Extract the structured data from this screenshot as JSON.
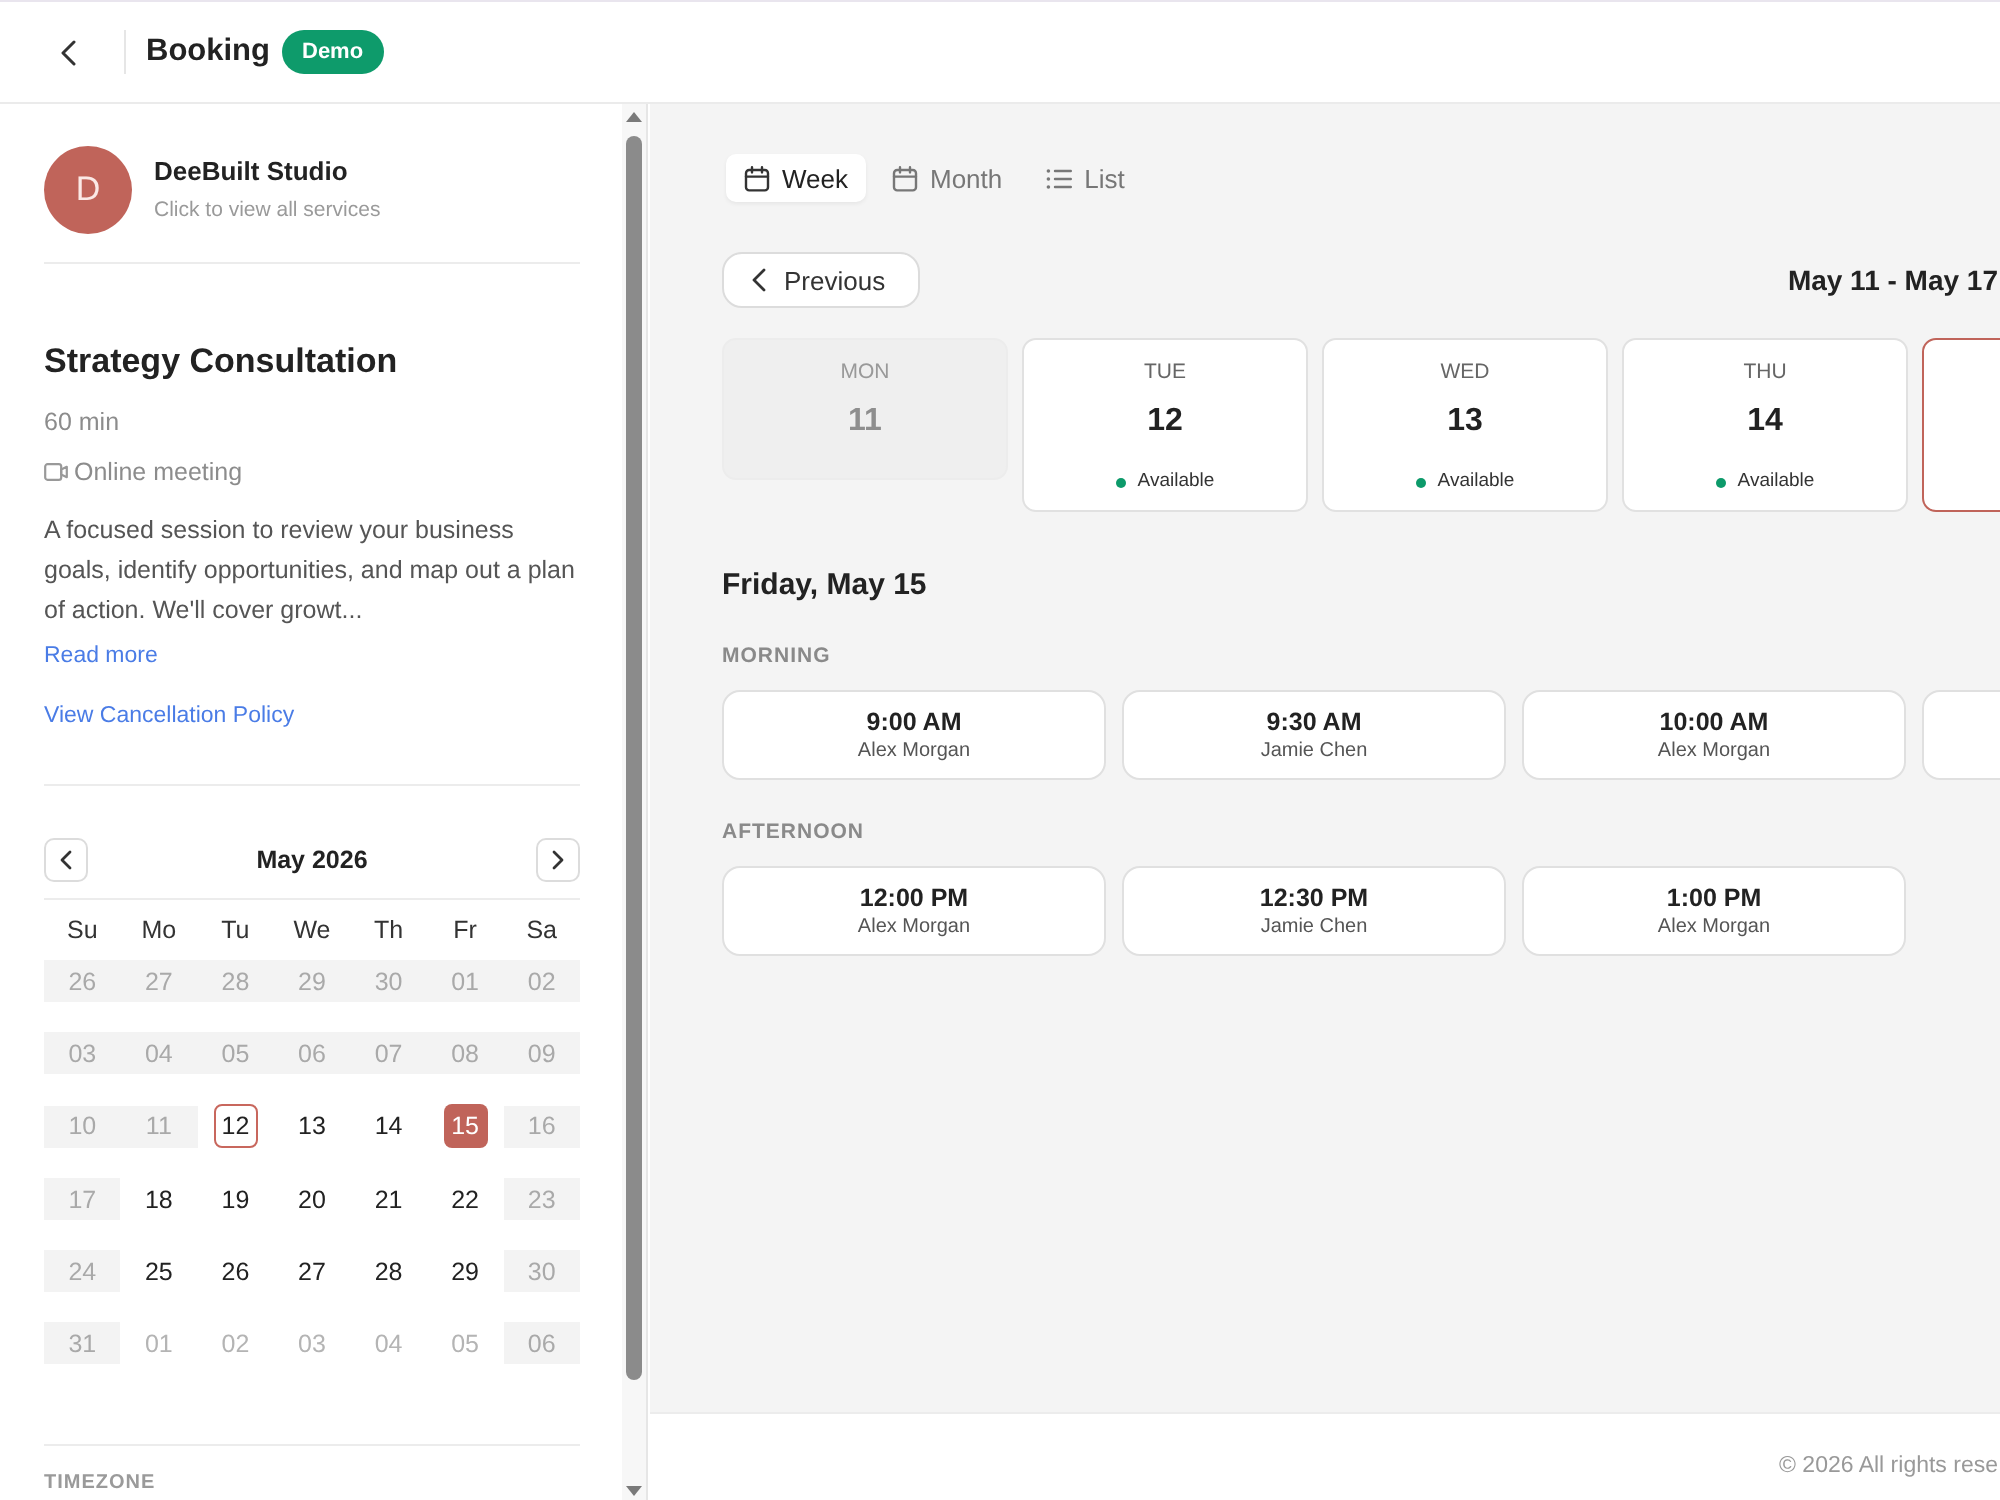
{
  "header": {
    "title": "Booking",
    "badge": "Demo"
  },
  "provider": {
    "initial": "D",
    "name": "DeeBuilt Studio",
    "subtitle": "Click to view all services"
  },
  "service": {
    "title": "Strategy Consultation",
    "duration": "60 min",
    "location": "Online meeting",
    "description": "A focused session to review your business goals, identify opportunities, and map out a plan of action. We'll cover growt...",
    "read_more": "Read more",
    "policy_link": "View Cancellation Policy"
  },
  "calendar": {
    "month": "May 2026",
    "weekdays": [
      "Su",
      "Mo",
      "Tu",
      "We",
      "Th",
      "Fr",
      "Sa"
    ],
    "weeks": [
      [
        {
          "day": "26",
          "kind": "blocked",
          "today": false,
          "selected": false
        },
        {
          "day": "27",
          "kind": "blocked",
          "today": false,
          "selected": false
        },
        {
          "day": "28",
          "kind": "blocked",
          "today": false,
          "selected": false
        },
        {
          "day": "29",
          "kind": "blocked",
          "today": false,
          "selected": false
        },
        {
          "day": "30",
          "kind": "blocked",
          "today": false,
          "selected": false
        },
        {
          "day": "01",
          "kind": "blocked",
          "today": false,
          "selected": false
        },
        {
          "day": "02",
          "kind": "blocked",
          "today": false,
          "selected": false
        }
      ],
      [
        {
          "day": "03",
          "kind": "blocked",
          "today": false,
          "selected": false
        },
        {
          "day": "04",
          "kind": "blocked",
          "today": false,
          "selected": false
        },
        {
          "day": "05",
          "kind": "blocked",
          "today": false,
          "selected": false
        },
        {
          "day": "06",
          "kind": "blocked",
          "today": false,
          "selected": false
        },
        {
          "day": "07",
          "kind": "blocked",
          "today": false,
          "selected": false
        },
        {
          "day": "08",
          "kind": "blocked",
          "today": false,
          "selected": false
        },
        {
          "day": "09",
          "kind": "blocked",
          "today": false,
          "selected": false
        }
      ],
      [
        {
          "day": "10",
          "kind": "blocked",
          "today": false,
          "selected": false
        },
        {
          "day": "11",
          "kind": "blocked",
          "today": false,
          "selected": false
        },
        {
          "day": "12",
          "kind": "open",
          "today": true,
          "selected": false
        },
        {
          "day": "13",
          "kind": "open",
          "today": false,
          "selected": false
        },
        {
          "day": "14",
          "kind": "open",
          "today": false,
          "selected": false
        },
        {
          "day": "15",
          "kind": "open",
          "today": false,
          "selected": true
        },
        {
          "day": "16",
          "kind": "blocked",
          "today": false,
          "selected": false
        }
      ],
      [
        {
          "day": "17",
          "kind": "blocked",
          "today": false,
          "selected": false
        },
        {
          "day": "18",
          "kind": "open",
          "today": false,
          "selected": false
        },
        {
          "day": "19",
          "kind": "open",
          "today": false,
          "selected": false
        },
        {
          "day": "20",
          "kind": "open",
          "today": false,
          "selected": false
        },
        {
          "day": "21",
          "kind": "open",
          "today": false,
          "selected": false
        },
        {
          "day": "22",
          "kind": "open",
          "today": false,
          "selected": false
        },
        {
          "day": "23",
          "kind": "blocked",
          "today": false,
          "selected": false
        }
      ],
      [
        {
          "day": "24",
          "kind": "blocked",
          "today": false,
          "selected": false
        },
        {
          "day": "25",
          "kind": "open",
          "today": false,
          "selected": false
        },
        {
          "day": "26",
          "kind": "open",
          "today": false,
          "selected": false
        },
        {
          "day": "27",
          "kind": "open",
          "today": false,
          "selected": false
        },
        {
          "day": "28",
          "kind": "open",
          "today": false,
          "selected": false
        },
        {
          "day": "29",
          "kind": "open",
          "today": false,
          "selected": false
        },
        {
          "day": "30",
          "kind": "blocked",
          "today": false,
          "selected": false
        }
      ],
      [
        {
          "day": "31",
          "kind": "blocked",
          "today": false,
          "selected": false
        },
        {
          "day": "01",
          "kind": "outside",
          "today": false,
          "selected": false
        },
        {
          "day": "02",
          "kind": "outside",
          "today": false,
          "selected": false
        },
        {
          "day": "03",
          "kind": "outside",
          "today": false,
          "selected": false
        },
        {
          "day": "04",
          "kind": "outside",
          "today": false,
          "selected": false
        },
        {
          "day": "05",
          "kind": "outside",
          "today": false,
          "selected": false
        },
        {
          "day": "06",
          "kind": "blocked",
          "today": false,
          "selected": false
        }
      ]
    ]
  },
  "timezone": {
    "label": "TIMEZONE"
  },
  "view_tabs": [
    {
      "label": "Week",
      "kind": "calendar",
      "selected": true
    },
    {
      "label": "Month",
      "kind": "calendar",
      "selected": false
    },
    {
      "label": "List",
      "kind": "list",
      "selected": false
    }
  ],
  "week": {
    "previous": "Previous",
    "range": "May 11 - May 17",
    "days": [
      {
        "weekday": "MON",
        "date": "11",
        "disabled": true,
        "selected": false
      },
      {
        "weekday": "TUE",
        "date": "12",
        "status": "Available",
        "disabled": false,
        "selected": false
      },
      {
        "weekday": "WED",
        "date": "13",
        "status": "Available",
        "disabled": false,
        "selected": false
      },
      {
        "weekday": "THU",
        "date": "14",
        "status": "Available",
        "disabled": false,
        "selected": false
      },
      {
        "disabled": false,
        "selected": true
      }
    ]
  },
  "day_title": "Friday, May 15",
  "periods": [
    {
      "label": "MORNING",
      "slots": [
        {
          "time": "9:00 AM",
          "staff": "Alex Morgan",
          "selected": false
        },
        {
          "time": "9:30 AM",
          "staff": "Jamie Chen",
          "selected": false
        },
        {
          "time": "10:00 AM",
          "staff": "Alex Morgan",
          "selected": false
        },
        {
          "selected": false
        }
      ]
    },
    {
      "label": "AFTERNOON",
      "slots": [
        {
          "time": "12:00 PM",
          "staff": "Alex Morgan",
          "selected": false
        },
        {
          "time": "12:30 PM",
          "staff": "Jamie Chen",
          "selected": false
        },
        {
          "time": "1:00 PM",
          "staff": "Alex Morgan",
          "selected": false
        }
      ]
    }
  ],
  "footer": {
    "copyright": "© 2026 All rights rese"
  }
}
